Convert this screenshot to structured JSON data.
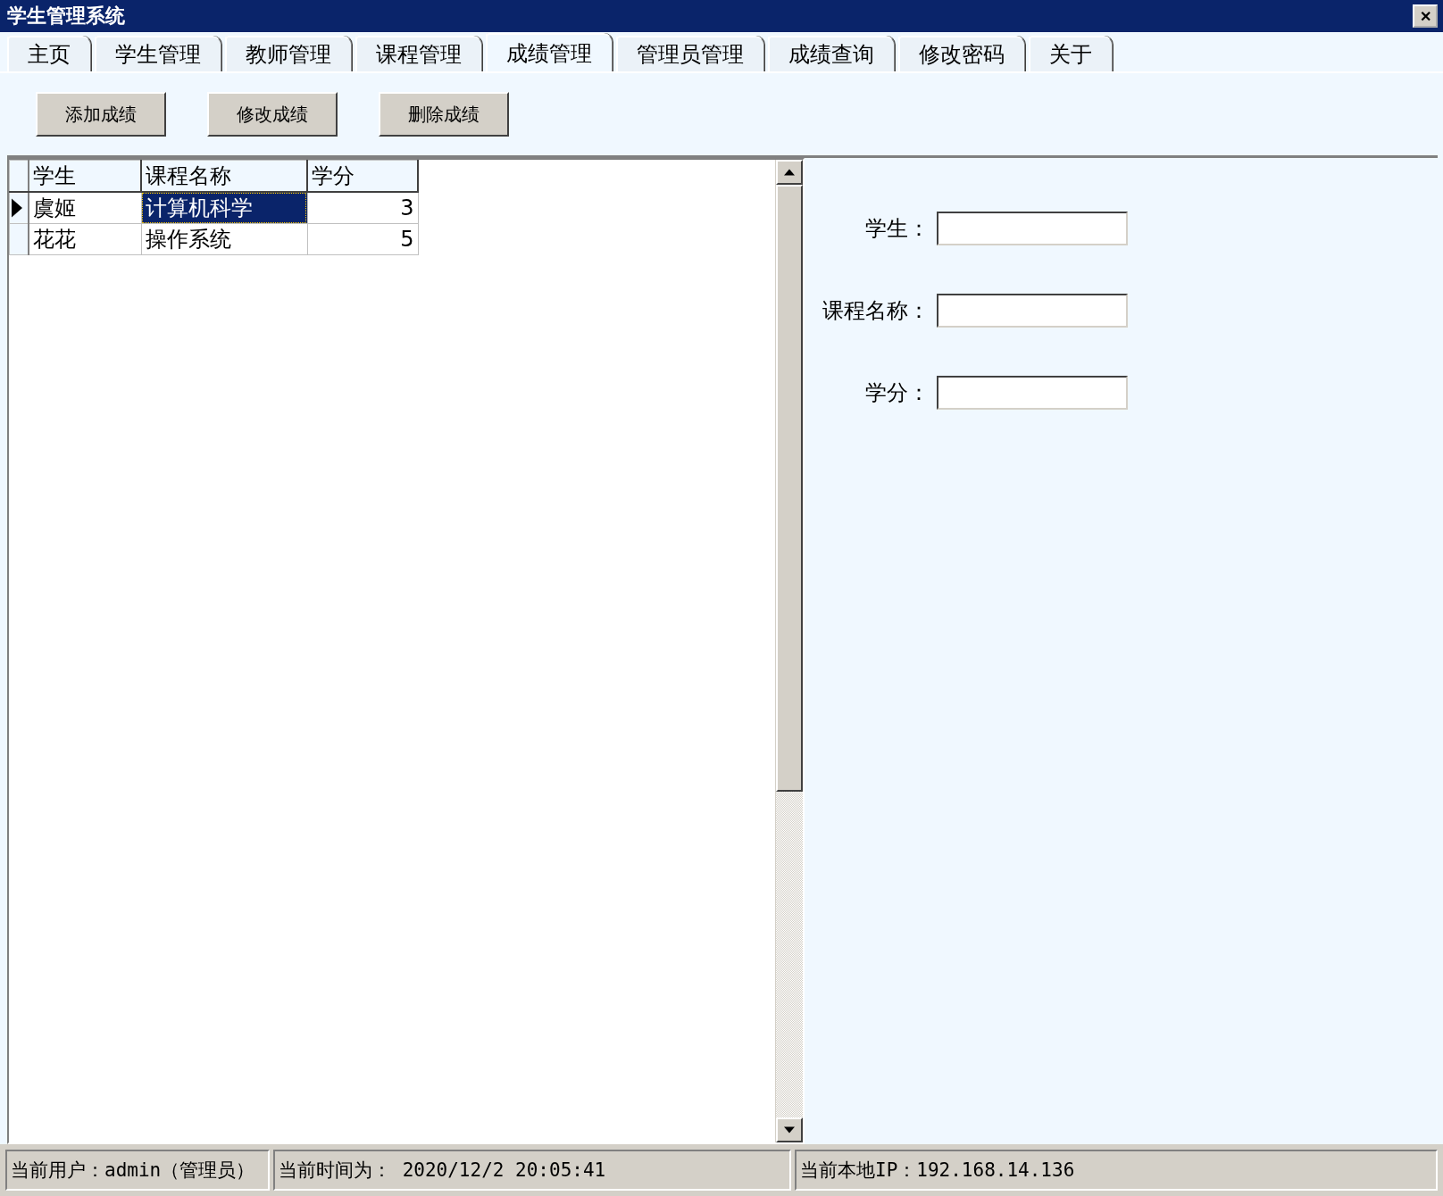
{
  "window": {
    "title": "学生管理系统",
    "close": "✕"
  },
  "tabs": [
    {
      "label": "主页",
      "selected": false
    },
    {
      "label": "学生管理",
      "selected": false
    },
    {
      "label": "教师管理",
      "selected": false
    },
    {
      "label": "课程管理",
      "selected": false
    },
    {
      "label": "成绩管理",
      "selected": true
    },
    {
      "label": "管理员管理",
      "selected": false
    },
    {
      "label": "成绩查询",
      "selected": false
    },
    {
      "label": "修改密码",
      "selected": false
    },
    {
      "label": "关于",
      "selected": false
    }
  ],
  "toolbar": {
    "buttons": [
      "添加成绩",
      "修改成绩",
      "删除成绩"
    ]
  },
  "table": {
    "columns": [
      "学生",
      "课程名称",
      "学分"
    ],
    "rows": [
      {
        "cells": [
          "虞姬",
          "计算机科学",
          "3"
        ],
        "selected": true
      },
      {
        "cells": [
          "花花",
          "操作系统",
          "5"
        ],
        "selected": false
      }
    ]
  },
  "form": {
    "fields": [
      {
        "label": "学生："
      },
      {
        "label": "课程名称："
      },
      {
        "label": "学分："
      }
    ]
  },
  "status_bar": {
    "user": "当前用户：admin（管理员）",
    "time": "当前时间为：  2020/12/2 20:05:41",
    "ip": "当前本地IP：192.168.14.136"
  }
}
